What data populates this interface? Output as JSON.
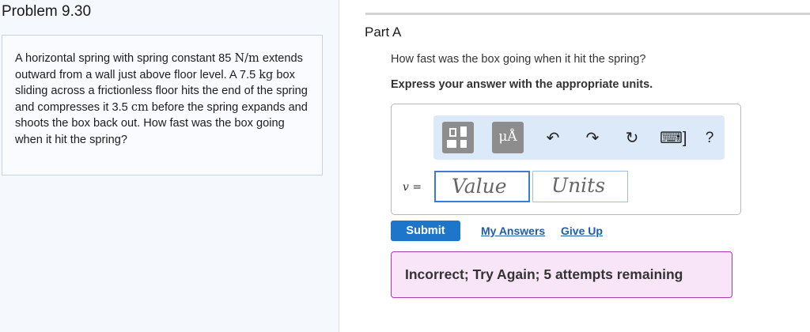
{
  "problem": {
    "title": "Problem 9.30",
    "text_parts": [
      "A horizontal spring with spring constant 85 ",
      "N/m",
      " extends outward from a wall just above floor level. A 7.5 ",
      "kg",
      " box sliding across a frictionless floor hits the end of the spring and compresses it 3.5 ",
      "cm",
      " before the spring expands and shoots the box back out. How fast was the box going when it hit the spring?"
    ]
  },
  "part": {
    "title": "Part A",
    "question": "How fast was the box going when it hit the spring?",
    "instruction": "Express your answer with the appropriate units."
  },
  "toolbar": {
    "templates_icon": "templates-icon",
    "units_label": "μÅ",
    "undo_glyph": "↶",
    "redo_glyph": "↷",
    "reset_glyph": "↻",
    "keyboard_glyph": "⌨]",
    "help_glyph": "?"
  },
  "answer": {
    "variable_label": "v =",
    "value_placeholder": "Value",
    "units_placeholder": "Units"
  },
  "actions": {
    "submit_label": "Submit",
    "my_answers_label": "My Answers",
    "give_up_label": "Give Up"
  },
  "feedback": {
    "message": "Incorrect; Try Again; 5 attempts remaining"
  },
  "colors": {
    "submit_bg": "#1d76c9",
    "feedback_bg": "#f8e6f8",
    "feedback_border": "#a93ba9",
    "toolbar_bg": "#dbe9f8",
    "link": "#1e5ea8"
  }
}
